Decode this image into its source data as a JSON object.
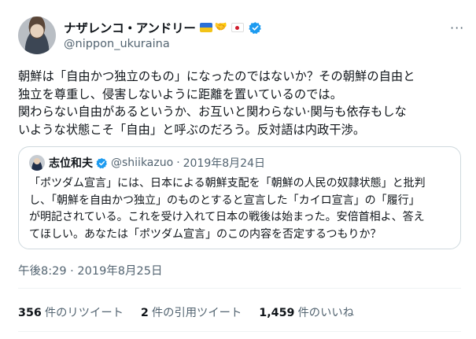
{
  "author": {
    "display_name": "ナザレンコ・アンドリー",
    "handle": "@nippon_ukuraina",
    "badges": [
      "ukraine-flag",
      "handshake",
      "japan-flag"
    ],
    "verified": true
  },
  "more_icon": "···",
  "tweet": {
    "text": "朝鮮は「自由かつ独立のもの」になったのではないか？その朝鮮の自由と\n独立を尊重し、侵害しないように距離を置いているのでは。\n関わらない自由があるというか、お互いと関わらない·関与も依存もしな\nいような状態こそ「自由」と呼ぶのだろう。反対語は内政干渉。",
    "timestamp": "午後8:29 · 2019年8月25日"
  },
  "quoted_tweet": {
    "display_name": "志位和夫",
    "handle": "@shiikazuo",
    "separator": "·",
    "date": "2019年8月24日",
    "verified": true,
    "text": "「ポツダム宣言」には、日本による朝鮮支配を「朝鮮の人民の奴隷状態」と批判\nし、「朝鮮を自由かつ独立」のものとすると宣言した「カイロ宣言」の「履行」\nが明記されている。これを受け入れて日本の戦後は始まった。安倍首相よ、答え\nてほしい。あなたは「ポツダム宣言」のこの内容を否定するつもりか？"
  },
  "stats": {
    "retweets": {
      "count": "356",
      "label": "件のリツイート"
    },
    "quote_tweets": {
      "count": "2",
      "label": "件の引用ツイート"
    },
    "likes": {
      "count": "1,459",
      "label": "件のいいね"
    }
  },
  "colors": {
    "verified": "#1d9bf0",
    "muted": "#536471",
    "border": "#cfd9de"
  }
}
